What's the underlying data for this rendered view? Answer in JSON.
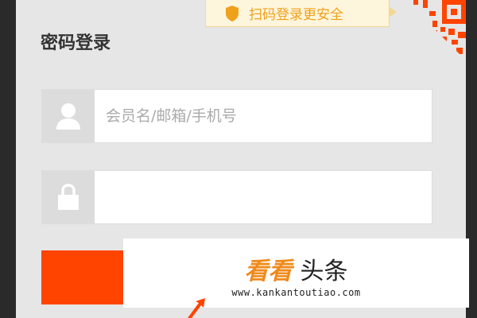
{
  "login": {
    "title": "密码登录",
    "tip": "扫码登录更安全",
    "username_placeholder": "会员名/邮箱/手机号",
    "password_value": ""
  },
  "watermark": {
    "brand": "看看",
    "brand_suffix": "头条",
    "url": "www.kankantoutiao.com"
  },
  "colors": {
    "accent": "#ff4400",
    "tip_text": "#f0a11b",
    "watermark_brand": "#f08a1c"
  },
  "icons": {
    "tip": "shield-icon",
    "username": "user-icon",
    "password": "lock-icon",
    "qr": "qr-code-icon"
  }
}
